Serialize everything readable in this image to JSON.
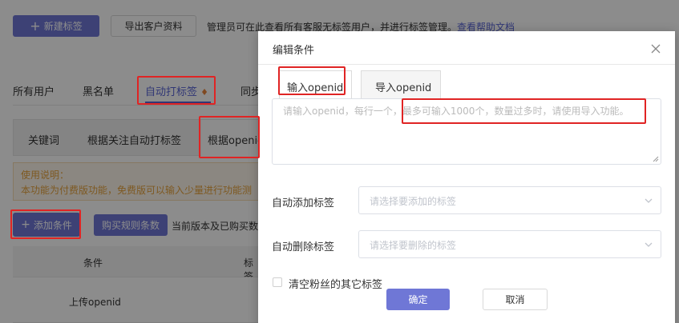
{
  "toolbar": {
    "new_tag_label": "新建标签",
    "export_label": "导出客户资料",
    "desc": "管理员可在此查看所有客服无标签用户，并进行标签管理。",
    "help_link": "查看帮助文档"
  },
  "main_tabs": [
    "所有用户",
    "黑名单",
    "自动打标签",
    "同步"
  ],
  "sub_tabs": [
    "关键词",
    "根据关注自动打标签",
    "根据openid"
  ],
  "notice": {
    "title": "使用说明：",
    "text": "本功能为付费版功能，免费版可以输入少量进行功能测"
  },
  "actions": {
    "add_condition": "添加条件",
    "buy_rules": "购买规则条数",
    "quota_text": "当前版本及已购买数"
  },
  "table": {
    "headers": [
      "条件",
      "标签"
    ],
    "rows": [
      [
        "上传openid",
        ""
      ]
    ]
  },
  "modal": {
    "title": "编辑条件",
    "tabs": [
      "输入openid",
      "导入openid"
    ],
    "textarea_placeholder": "请输入openid，每行一个，最多可输入1000个，数量过多时，请使用导入功能。",
    "add_tag_label": "自动添加标签",
    "add_tag_placeholder": "请选择要添加的标签",
    "remove_tag_label": "自动删除标签",
    "remove_tag_placeholder": "请选择要删除的标签",
    "clear_label": "清空粉丝的其它标签",
    "confirm_label": "确定",
    "cancel_label": "取消"
  },
  "colors": {
    "primary": "#6f77d6",
    "link": "#5965d6",
    "highlight": "#e02424"
  },
  "icons": [
    "plus-icon",
    "crown-icon",
    "close-icon",
    "chevron-down-icon"
  ]
}
